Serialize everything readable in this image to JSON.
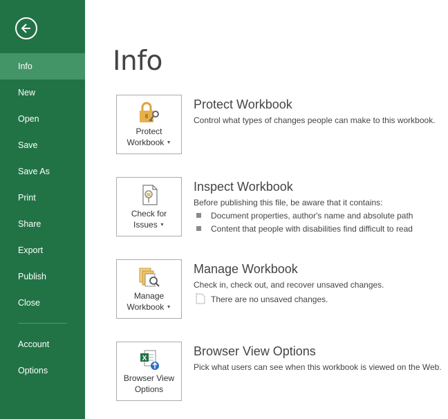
{
  "sidebar": {
    "back_icon": "back-arrow-icon",
    "items": [
      {
        "label": "Info",
        "active": true
      },
      {
        "label": "New"
      },
      {
        "label": "Open"
      },
      {
        "label": "Save"
      },
      {
        "label": "Save As"
      },
      {
        "label": "Print"
      },
      {
        "label": "Share"
      },
      {
        "label": "Export"
      },
      {
        "label": "Publish"
      },
      {
        "label": "Close"
      }
    ],
    "bottom_items": [
      {
        "label": "Account"
      },
      {
        "label": "Options"
      }
    ],
    "colors": {
      "background": "#217346",
      "active": "#439467"
    }
  },
  "main": {
    "title": "Info",
    "sections": [
      {
        "button_line1": "Protect",
        "button_line2": "Workbook",
        "button_icon": "lock-key-icon",
        "title": "Protect Workbook",
        "desc": "Control what types of changes people can make to this workbook."
      },
      {
        "button_line1": "Check for",
        "button_line2": "Issues",
        "button_icon": "inspect-document-icon",
        "title": "Inspect Workbook",
        "desc": "Before publishing this file, be aware that it contains:",
        "bullets": [
          "Document properties, author's name and absolute path",
          "Content that people with disabilities find difficult to read"
        ]
      },
      {
        "button_line1": "Manage",
        "button_line2": "Workbook",
        "button_icon": "manage-versions-icon",
        "title": "Manage Workbook",
        "desc": "Check in, check out, and recover unsaved changes.",
        "note": "There are no unsaved changes."
      },
      {
        "button_line1": "Browser View",
        "button_line2": "Options",
        "button_icon": "excel-browser-icon",
        "title": "Browser View Options",
        "desc": "Pick what users can see when this workbook is viewed on the Web."
      }
    ]
  }
}
